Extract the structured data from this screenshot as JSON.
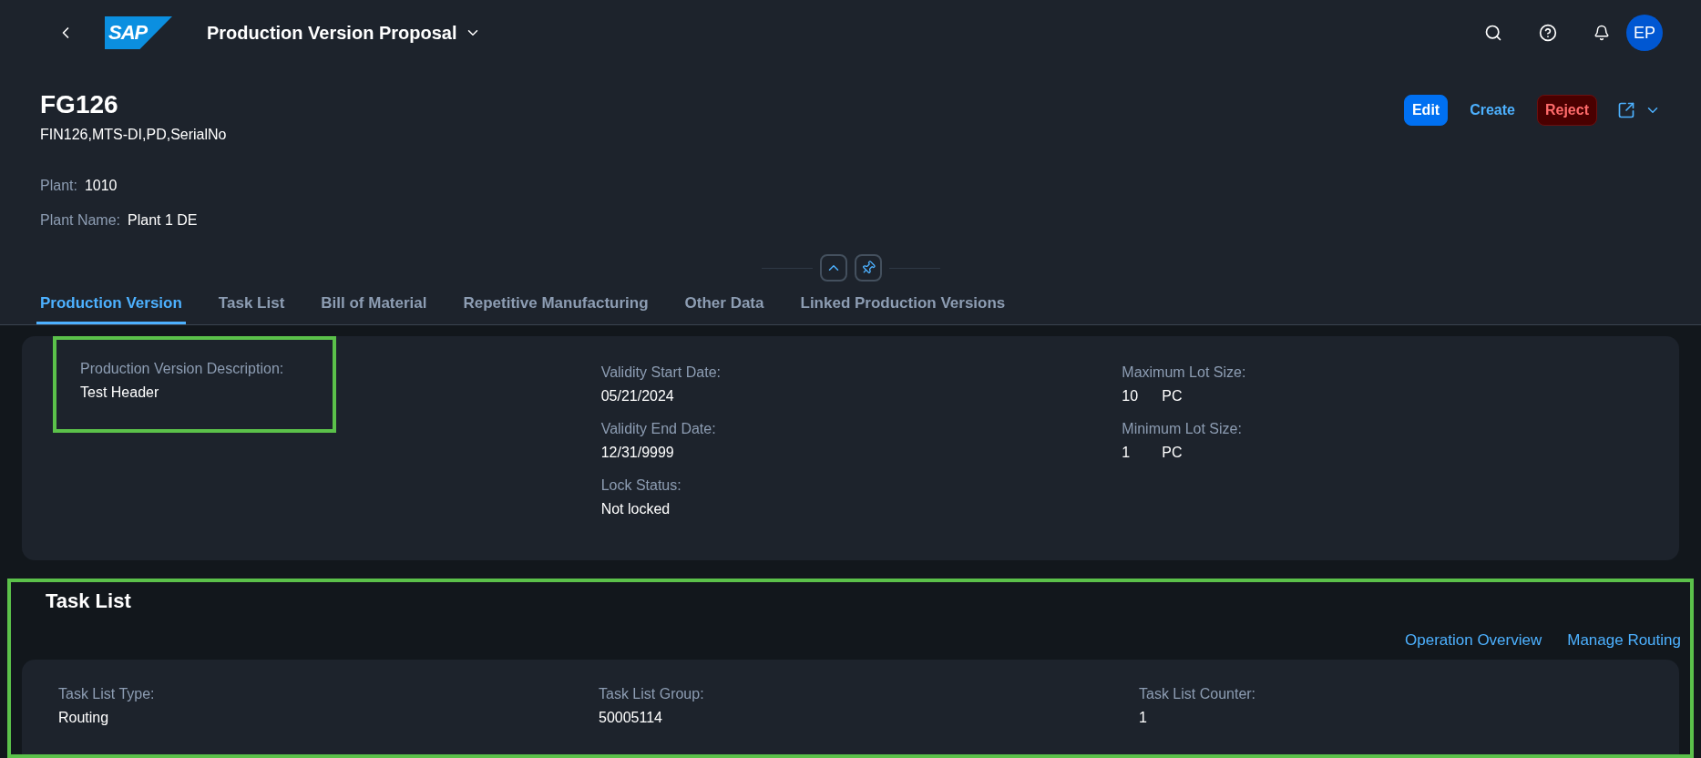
{
  "shell": {
    "logo": "SAP",
    "title": "Production Version Proposal",
    "avatar": "EP"
  },
  "header": {
    "title": "FG126",
    "subtitle": "FIN126,MTS-DI,PD,SerialNo",
    "attributes": [
      {
        "label": "Plant:",
        "value": "1010"
      },
      {
        "label": "Plant Name:",
        "value": "Plant 1 DE"
      }
    ],
    "actions": [
      {
        "label": "Edit",
        "kind": "emphasized"
      },
      {
        "label": "Create",
        "kind": "transparent"
      },
      {
        "label": "Reject",
        "kind": "reject"
      }
    ]
  },
  "tabs": [
    {
      "label": "Production Version",
      "selected": true
    },
    {
      "label": "Task List",
      "selected": false
    },
    {
      "label": "Bill of Material",
      "selected": false
    },
    {
      "label": "Repetitive Manufacturing",
      "selected": false
    },
    {
      "label": "Other Data",
      "selected": false
    },
    {
      "label": "Linked Production Versions",
      "selected": false
    }
  ],
  "general": {
    "columns": [
      [
        {
          "label": "Production Version Description:",
          "kind": "text",
          "value": "Test Header",
          "highlighted": true
        }
      ],
      [
        {
          "label": "Validity Start Date:",
          "kind": "text",
          "value": "05/21/2024",
          "highlighted": false
        },
        {
          "label": "Validity End Date:",
          "kind": "text",
          "value": "12/31/9999",
          "highlighted": false
        },
        {
          "label": "Lock Status:",
          "kind": "text",
          "value": "Not locked",
          "highlighted": false
        }
      ],
      [
        {
          "label": "Maximum Lot Size:",
          "kind": "quantity",
          "value": "10",
          "unit": "PC",
          "highlighted": false
        },
        {
          "label": "Minimum Lot Size:",
          "kind": "quantity",
          "value": "1",
          "unit": "PC",
          "highlighted": false
        }
      ]
    ]
  },
  "task_list": {
    "title": "Task List",
    "highlighted": true,
    "links": [
      "Operation Overview",
      "Manage Routing"
    ],
    "columns": [
      [
        {
          "label": "Task List Type:",
          "kind": "text",
          "value": "Routing",
          "highlighted": false
        }
      ],
      [
        {
          "label": "Task List Group:",
          "kind": "text",
          "value": "50005114",
          "highlighted": false
        }
      ],
      [
        {
          "label": "Task List Counter:",
          "kind": "text",
          "value": "1",
          "highlighted": false
        }
      ]
    ]
  }
}
